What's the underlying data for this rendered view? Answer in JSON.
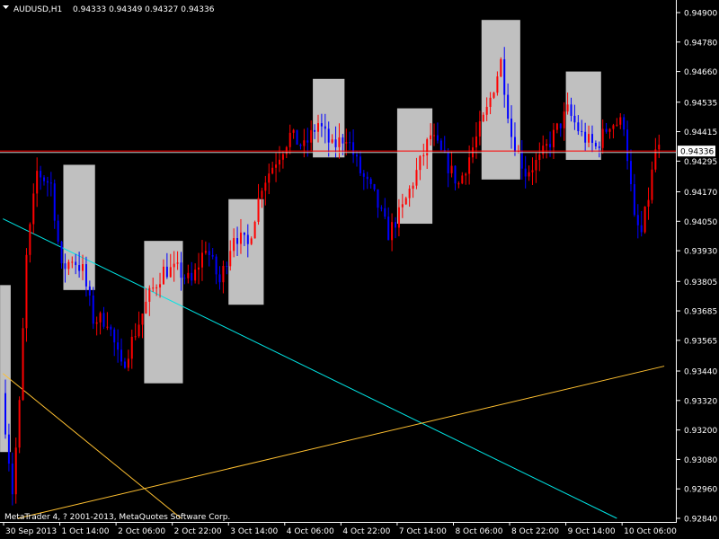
{
  "header": {
    "symbol_tf": "AUDUSD,H1",
    "ohlc": "0.94333 0.94349 0.94327 0.94336",
    "dropdown_icon": "triangle-down-icon"
  },
  "footer": {
    "copyright": "MetaTrader 4, ? 2001-2013, MetaQuotes Software Corp."
  },
  "colors": {
    "background": "#000000",
    "bull": "#ff0000",
    "bear": "#0000ff",
    "highlight_box": "#c0c0c0",
    "bid_line": "#ff0000",
    "ask_line": "#c0c0c0",
    "trendline_cyan": "#00e5e5",
    "trendline_yellow": "#ffc030",
    "price_tag_bg": "#ffffff",
    "price_tag_text": "#000000",
    "axis": "#ffffff"
  },
  "chart_data": {
    "type": "candlestick",
    "symbol": "AUDUSD",
    "timeframe": "H1",
    "ylim": [
      0.9284,
      0.949
    ],
    "y_ticks": [
      "0.94900",
      "0.94780",
      "0.94660",
      "0.94535",
      "0.94415",
      "0.94295",
      "0.94170",
      "0.94050",
      "0.93930",
      "0.93805",
      "0.93685",
      "0.93565",
      "0.93440",
      "0.93320",
      "0.93200",
      "0.93080",
      "0.92960",
      "0.92840"
    ],
    "x_labels": [
      "30 Sep 2013",
      "1 Oct 14:00",
      "2 Oct 06:00",
      "2 Oct 22:00",
      "3 Oct 14:00",
      "4 Oct 06:00",
      "4 Oct 22:00",
      "7 Oct 14:00",
      "8 Oct 06:00",
      "8 Oct 22:00",
      "9 Oct 14:00",
      "10 Oct 06:00"
    ],
    "current_price": "0.94336",
    "ask_price": 0.9433,
    "bars_per_label": 16,
    "anchors": [
      {
        "bar": 0,
        "price": 0.9335
      },
      {
        "bar": 3,
        "price": 0.9295
      },
      {
        "bar": 5,
        "price": 0.933
      },
      {
        "bar": 7,
        "price": 0.939
      },
      {
        "bar": 10,
        "price": 0.9425
      },
      {
        "bar": 14,
        "price": 0.942
      },
      {
        "bar": 17,
        "price": 0.9385
      },
      {
        "bar": 20,
        "price": 0.939
      },
      {
        "bar": 23,
        "price": 0.9385
      },
      {
        "bar": 26,
        "price": 0.9365
      },
      {
        "bar": 30,
        "price": 0.9365
      },
      {
        "bar": 34,
        "price": 0.9345
      },
      {
        "bar": 38,
        "price": 0.936
      },
      {
        "bar": 42,
        "price": 0.9375
      },
      {
        "bar": 46,
        "price": 0.9385
      },
      {
        "bar": 50,
        "price": 0.9385
      },
      {
        "bar": 54,
        "price": 0.938
      },
      {
        "bar": 58,
        "price": 0.9395
      },
      {
        "bar": 62,
        "price": 0.938
      },
      {
        "bar": 66,
        "price": 0.94
      },
      {
        "bar": 70,
        "price": 0.9395
      },
      {
        "bar": 74,
        "price": 0.942
      },
      {
        "bar": 78,
        "price": 0.943
      },
      {
        "bar": 82,
        "price": 0.944
      },
      {
        "bar": 86,
        "price": 0.9435
      },
      {
        "bar": 90,
        "price": 0.9445
      },
      {
        "bar": 94,
        "price": 0.9435
      },
      {
        "bar": 98,
        "price": 0.944
      },
      {
        "bar": 102,
        "price": 0.9425
      },
      {
        "bar": 106,
        "price": 0.9415
      },
      {
        "bar": 110,
        "price": 0.94
      },
      {
        "bar": 114,
        "price": 0.941
      },
      {
        "bar": 118,
        "price": 0.9425
      },
      {
        "bar": 122,
        "price": 0.944
      },
      {
        "bar": 126,
        "price": 0.943
      },
      {
        "bar": 130,
        "price": 0.942
      },
      {
        "bar": 134,
        "price": 0.9435
      },
      {
        "bar": 138,
        "price": 0.945
      },
      {
        "bar": 142,
        "price": 0.947
      },
      {
        "bar": 145,
        "price": 0.944
      },
      {
        "bar": 149,
        "price": 0.9425
      },
      {
        "bar": 153,
        "price": 0.943
      },
      {
        "bar": 157,
        "price": 0.944
      },
      {
        "bar": 161,
        "price": 0.945
      },
      {
        "bar": 165,
        "price": 0.944
      },
      {
        "bar": 169,
        "price": 0.9435
      },
      {
        "bar": 173,
        "price": 0.9445
      },
      {
        "bar": 177,
        "price": 0.9445
      },
      {
        "bar": 180,
        "price": 0.9405
      },
      {
        "bar": 182,
        "price": 0.94
      },
      {
        "bar": 184,
        "price": 0.9415
      },
      {
        "bar": 186,
        "price": 0.9434
      }
    ],
    "highlight_boxes": [
      {
        "from_bar": -1,
        "to_bar": 1,
        "high": 0.9379,
        "low": 0.9311
      },
      {
        "from_bar": 17,
        "to_bar": 25,
        "high": 0.9428,
        "low": 0.9377
      },
      {
        "from_bar": 40,
        "to_bar": 50,
        "high": 0.9397,
        "low": 0.9339
      },
      {
        "from_bar": 64,
        "to_bar": 73,
        "high": 0.9414,
        "low": 0.9371
      },
      {
        "from_bar": 88,
        "to_bar": 96,
        "high": 0.9463,
        "low": 0.9431
      },
      {
        "from_bar": 112,
        "to_bar": 121,
        "high": 0.9451,
        "low": 0.9404
      },
      {
        "from_bar": 136,
        "to_bar": 146,
        "high": 0.9487,
        "low": 0.9422
      },
      {
        "from_bar": 160,
        "to_bar": 169,
        "high": 0.9466,
        "low": 0.943
      }
    ],
    "trendlines": [
      {
        "color_key": "trendline_cyan",
        "from": {
          "bar": -0.7,
          "price": 0.9406
        },
        "to": {
          "bar": 174,
          "price": 0.9284
        }
      },
      {
        "color_key": "trendline_yellow",
        "from": {
          "bar": -0.7,
          "price": 0.9343
        },
        "to": {
          "bar": 50,
          "price": 0.9284
        }
      },
      {
        "color_key": "trendline_yellow",
        "from": {
          "bar": 3.5,
          "price": 0.9284
        },
        "to": {
          "bar": 187.5,
          "price": 0.9346
        }
      }
    ]
  }
}
